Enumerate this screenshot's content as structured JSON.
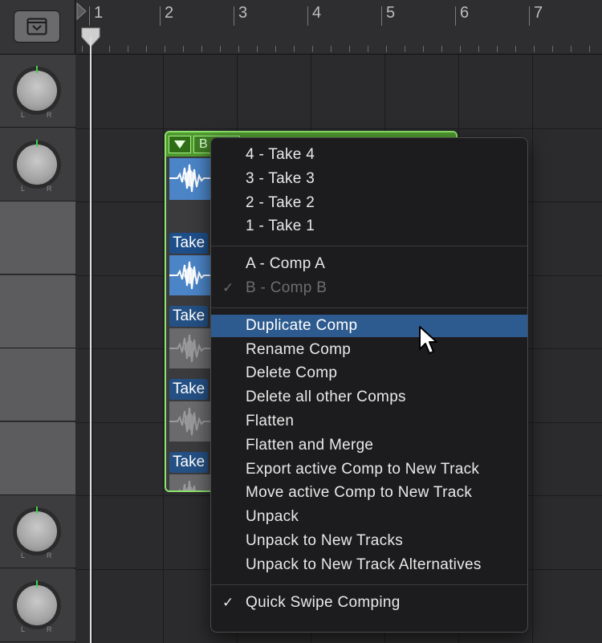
{
  "ruler": {
    "bars": [
      "1",
      "2",
      "3",
      "4",
      "5",
      "6",
      "7"
    ]
  },
  "tracks": [
    {
      "kind": "pan",
      "left": "L",
      "right": "R"
    },
    {
      "kind": "pan",
      "left": "L",
      "right": "R"
    },
    {
      "kind": "empty"
    },
    {
      "kind": "empty"
    },
    {
      "kind": "empty"
    },
    {
      "kind": "empty"
    },
    {
      "kind": "pan",
      "left": "L",
      "right": "R"
    },
    {
      "kind": "pan",
      "left": "L",
      "right": "R"
    }
  ],
  "take_folder": {
    "comp_label": "B",
    "lanes": [
      {
        "label": "",
        "color": "blue"
      },
      {
        "label": "Take",
        "color": "blue"
      },
      {
        "label": "Take",
        "color": "grey"
      },
      {
        "label": "Take",
        "color": "grey"
      },
      {
        "label": "Take",
        "color": "grey"
      }
    ],
    "border_color": "#8de36b"
  },
  "menu": {
    "groups": [
      [
        {
          "label": "4 - Take 4"
        },
        {
          "label": "3 - Take 3"
        },
        {
          "label": "2 - Take 2"
        },
        {
          "label": "1 - Take 1"
        }
      ],
      [
        {
          "label": "A - Comp A"
        },
        {
          "label": "B - Comp B",
          "checked": true,
          "disabled": true
        }
      ],
      [
        {
          "label": "Duplicate Comp",
          "highlighted": true
        },
        {
          "label": "Rename Comp"
        },
        {
          "label": "Delete Comp"
        },
        {
          "label": "Delete all other Comps"
        },
        {
          "label": "Flatten"
        },
        {
          "label": "Flatten and Merge"
        },
        {
          "label": "Export active Comp to New Track"
        },
        {
          "label": "Move active Comp to New Track"
        },
        {
          "label": "Unpack"
        },
        {
          "label": "Unpack to New Tracks"
        },
        {
          "label": "Unpack to New Track Alternatives"
        }
      ],
      [
        {
          "label": "Quick Swipe Comping",
          "checked": true
        }
      ]
    ],
    "check_glyph": "✓",
    "highlight_color": "#2e5b8f"
  }
}
